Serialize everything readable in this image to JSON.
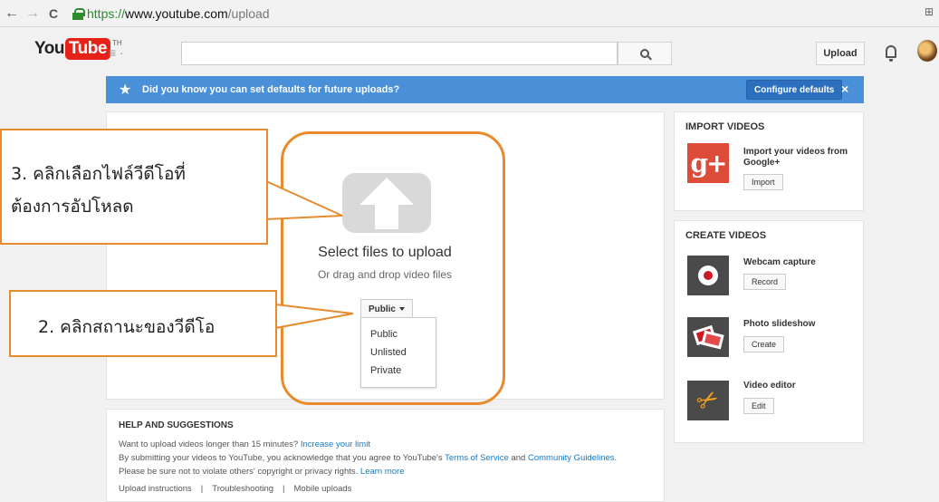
{
  "browser": {
    "back": "←",
    "forward": "→",
    "reload": "C",
    "url_scheme": "https://",
    "url_host": "www.youtube.com",
    "url_path": "/upload"
  },
  "header": {
    "logo_you": "You",
    "logo_tube": "Tube",
    "logo_region": "TH",
    "guide_icon": "≡ ·",
    "search_placeholder": "",
    "upload_label": "Upload"
  },
  "notice": {
    "star": "★",
    "text": "Did you know you can set defaults for future uploads?",
    "configure_label": "Configure defaults",
    "close": "×",
    "color": "#4a90d9"
  },
  "upload": {
    "title": "Select files to upload",
    "subtitle": "Or drag and drop video files",
    "privacy_selected": "Public",
    "privacy_options": [
      "Public",
      "Unlisted",
      "Private"
    ]
  },
  "import": {
    "title": "IMPORT VIDEOS",
    "gplus_label": "g+",
    "item_text": "Import your videos from Google+",
    "button": "Import"
  },
  "create": {
    "title": "CREATE VIDEOS",
    "items": [
      {
        "label": "Webcam capture",
        "button": "Record"
      },
      {
        "label": "Photo slideshow",
        "button": "Create"
      },
      {
        "label": "Video editor",
        "button": "Edit"
      }
    ]
  },
  "help": {
    "title": "HELP AND SUGGESTIONS",
    "line1_text": "Want to upload videos longer than 15 minutes?",
    "line1_link": "Increase your limit",
    "line2_a": "By submitting your videos to YouTube, you acknowledge that you agree to YouTube's",
    "line2_link1": "Terms of Service",
    "line2_b": "and",
    "line2_link2": "Community Guidelines",
    "line2_c": ".",
    "line3_text": "Please be sure not to violate others' copyright or privacy rights.",
    "line3_link": "Learn more",
    "links": [
      "Upload instructions",
      "Troubleshooting",
      "Mobile uploads"
    ],
    "separator": "|"
  },
  "callouts": {
    "step3_line1": "3. คลิกเลือกไฟล์วีดีโอที่",
    "step3_line2": "ต้องการอัปโหลด",
    "step2": "2. คลิกสถานะของวีดีโอ",
    "accent_color": "#e88a2e"
  }
}
